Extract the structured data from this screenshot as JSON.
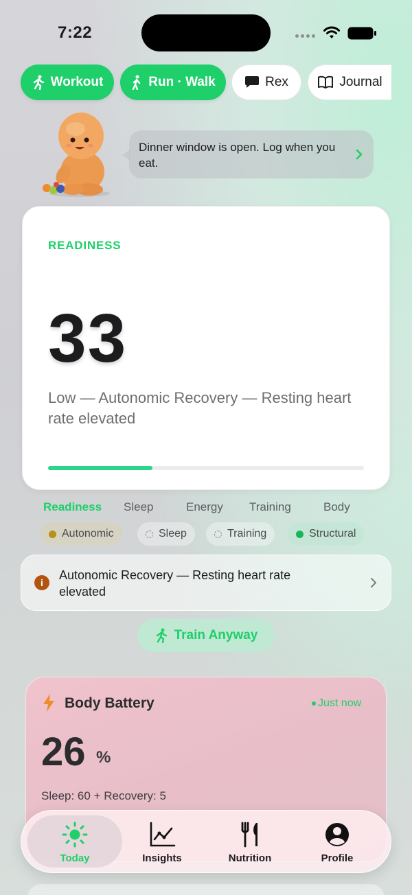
{
  "status": {
    "time": "7:22"
  },
  "quick_actions": [
    {
      "label": "Workout",
      "icon": "running-figure-icon"
    },
    {
      "label": "Run · Walk",
      "icon": "walking-figure-icon"
    },
    {
      "label": "Rex",
      "icon": "chat-bubble-icon"
    },
    {
      "label": "Journal",
      "icon": "book-icon"
    }
  ],
  "coach_bubble": {
    "text": "Dinner window is open. Log when you eat."
  },
  "readiness": {
    "label": "READINESS",
    "score": "33",
    "description": "Low — Autonomic Recovery — Resting heart rate elevated",
    "progress": 0.33
  },
  "metric_tabs": [
    "Readiness",
    "Sleep",
    "Energy",
    "Training",
    "Body"
  ],
  "active_tab": "Readiness",
  "filters": [
    {
      "label": "Autonomic",
      "state": "filled",
      "color": "#b8901a"
    },
    {
      "label": "Sleep",
      "state": "empty"
    },
    {
      "label": "Training",
      "state": "empty"
    },
    {
      "label": "Structural",
      "state": "filled",
      "color": "#17b65a"
    }
  ],
  "alert": {
    "text": "Autonomic Recovery — Resting heart rate elevated",
    "icon": "info-icon"
  },
  "train_button": {
    "label": "Train Anyway"
  },
  "body_battery": {
    "title": "Body Battery",
    "updated": "Just now",
    "value": "26",
    "unit": "%",
    "breakdown": "Sleep: 60 + Recovery: 5"
  },
  "tab_bar": [
    {
      "label": "Today",
      "icon": "sun-icon",
      "active": true
    },
    {
      "label": "Insights",
      "icon": "chart-line-icon",
      "active": false
    },
    {
      "label": "Nutrition",
      "icon": "fork-knife-icon",
      "active": false
    },
    {
      "label": "Profile",
      "icon": "person-circle-icon",
      "active": false
    }
  ],
  "colors": {
    "accent": "#1ecf6a",
    "warning": "#b3540e",
    "battery_card": "#f0c2cc"
  }
}
